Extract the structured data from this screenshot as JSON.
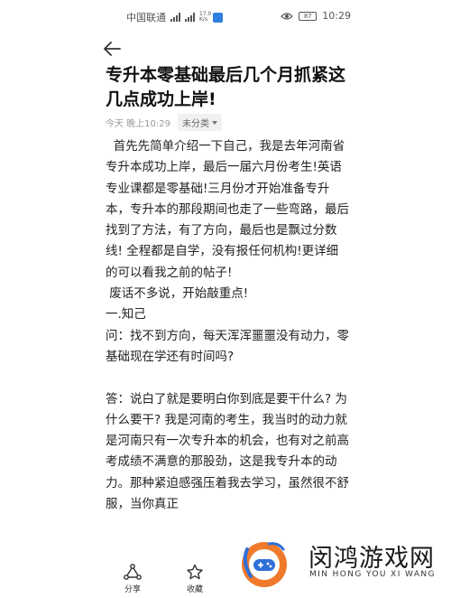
{
  "status_bar": {
    "carrier": "中国联通",
    "network_speed": "17.0 K/s",
    "battery": "87",
    "time": "10:29"
  },
  "article": {
    "title": "专升本零基础最后几个月抓紧这几点成功上岸!",
    "timestamp": "今天 晚上10:29",
    "category": "未分类",
    "paragraphs": [
      "  首先先简单介绍一下自己，我是去年河南省专升本成功上岸，最后一届六月份考生!英语专业课都是零基础!三月份才开始准备专升本，专升本的那段期间也走了一些弯路，最后找到了方法，有了方向，最后也是飘过分数线! 全程都是自学，没有报任何机构!更详细的可以看我之前的帖子!",
      " 废话不多说，开始敲重点!",
      "一.知己",
      "问：找不到方向，每天浑浑噩噩没有动力，零基础现在学还有时间吗?",
      "",
      "答：说白了就是要明白你到底是要干什么? 为什么要干? 我是河南的考生，我当时的动力就是河南只有一次专升本的机会，也有对之前高考成绩不满意的那股劲，这是我专升本的动力。那种紧迫感强压着我去学习，虽然很不舒服，当你真正"
    ]
  },
  "bottom_bar": {
    "share_label": "分享",
    "favorite_label": "收藏"
  },
  "watermark": {
    "name_cn": "闵鸿游戏网",
    "name_en": "MIN HONG YOU XI WANG"
  },
  "colors": {
    "accent_blue": "#2f7fe0",
    "logo_orange": "#f07a2c",
    "logo_blue": "#2f6fd8"
  },
  "icons": [
    "back-arrow-icon",
    "share-icon",
    "star-icon",
    "signal-icon",
    "eye-icon",
    "battery-icon"
  ]
}
